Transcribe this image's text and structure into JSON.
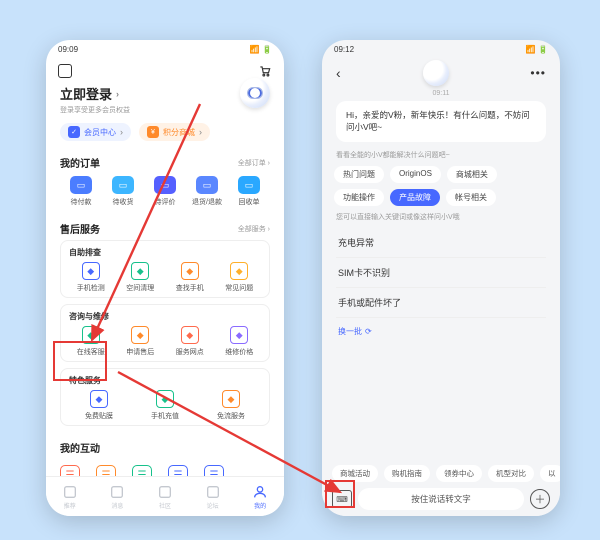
{
  "left": {
    "status_time": "09:09",
    "login_title": "立即登录",
    "login_sub": "登录享受更多会员权益",
    "pill_member": "会员中心",
    "pill_points": "积分商城",
    "orders_title": "我的订单",
    "orders_more": "全部订单",
    "orders": [
      {
        "label": "待付款",
        "color": "#4b7dff"
      },
      {
        "label": "待收货",
        "color": "#3db6ff"
      },
      {
        "label": "待评价",
        "color": "#5560ff"
      },
      {
        "label": "退货/退款",
        "color": "#5a87ff"
      },
      {
        "label": "回收单",
        "color": "#2aa8ff"
      }
    ],
    "service_title": "售后服务",
    "service_more": "全部服务",
    "group1_title": "自助排查",
    "group1": [
      {
        "label": "手机检测",
        "c": "#4768ff"
      },
      {
        "label": "空间清理",
        "c": "#17c18b"
      },
      {
        "label": "查找手机",
        "c": "#ff8a2b"
      },
      {
        "label": "常见问题",
        "c": "#ffb02b"
      }
    ],
    "group2_title": "咨询与维修",
    "group2": [
      {
        "label": "在线客服",
        "c": "#17c18b"
      },
      {
        "label": "申请售后",
        "c": "#ff8a2b"
      },
      {
        "label": "服务网点",
        "c": "#ff6a4d"
      },
      {
        "label": "维修价格",
        "c": "#8a6bff"
      }
    ],
    "group3_title": "特色服务",
    "group3": [
      {
        "label": "免费贴膜",
        "c": "#4768ff"
      },
      {
        "label": "手机充值",
        "c": "#17c18b"
      },
      {
        "label": "免流服务",
        "c": "#ff8a2b"
      }
    ],
    "hudong_title": "我的互动",
    "tabs": [
      "推荐",
      "消息",
      "社区",
      "论坛",
      "我的"
    ]
  },
  "right": {
    "status_time": "09:12",
    "ts": "09:11",
    "greeting": "Hi，亲爱的V粉，新年快乐！有什么问题，不妨问问小V吧~",
    "hint1": "看看全能的小V都能解决什么问题吧~",
    "chips": [
      "热门问题",
      "OriginOS",
      "商城相关",
      "功能操作",
      "产品故障",
      "帐号相关"
    ],
    "chip_active_index": 4,
    "hint2": "您可以直接输入关键词或像这样问小V哦",
    "questions": [
      "充电异常",
      "SIM卡不识别",
      "手机或配件坏了"
    ],
    "refresh": "换一批",
    "bottom_tags": [
      "商城活动",
      "购机指南",
      "领券中心",
      "机型对比",
      "以"
    ],
    "voice_placeholder": "按住说话转文字"
  }
}
